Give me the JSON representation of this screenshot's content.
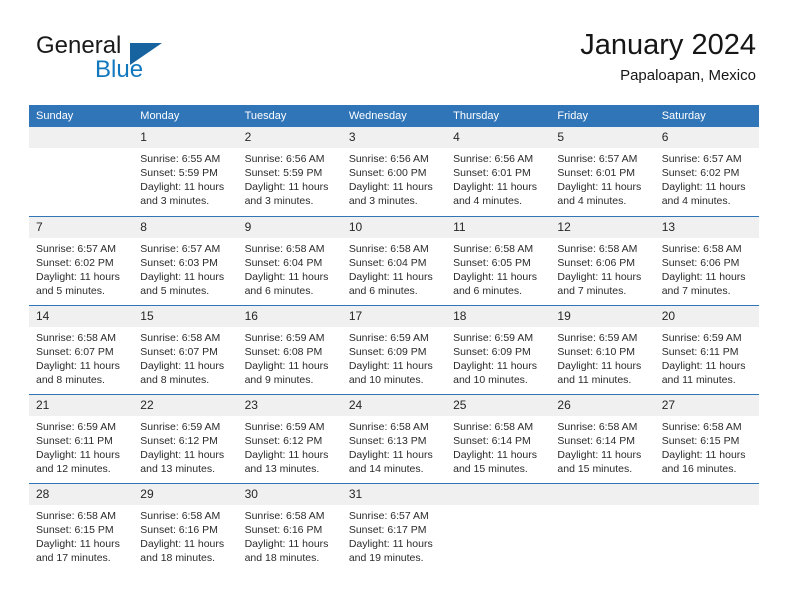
{
  "brand": {
    "name_part1": "General",
    "name_part2": "Blue",
    "logo_icon": "triangle-logo-icon"
  },
  "header": {
    "title": "January 2024",
    "subtitle": "Papaloapan, Mexico"
  },
  "calendar": {
    "weekday_headers": [
      "Sunday",
      "Monday",
      "Tuesday",
      "Wednesday",
      "Thursday",
      "Friday",
      "Saturday"
    ],
    "accent_color": "#3075b8",
    "daynum_background": "#f0f0f0",
    "weeks": [
      [
        {
          "day": "",
          "blank": true
        },
        {
          "day": "1",
          "sunrise": "Sunrise: 6:55 AM",
          "sunset": "Sunset: 5:59 PM",
          "daylight_line1": "Daylight: 11 hours",
          "daylight_line2": "and 3 minutes."
        },
        {
          "day": "2",
          "sunrise": "Sunrise: 6:56 AM",
          "sunset": "Sunset: 5:59 PM",
          "daylight_line1": "Daylight: 11 hours",
          "daylight_line2": "and 3 minutes."
        },
        {
          "day": "3",
          "sunrise": "Sunrise: 6:56 AM",
          "sunset": "Sunset: 6:00 PM",
          "daylight_line1": "Daylight: 11 hours",
          "daylight_line2": "and 3 minutes."
        },
        {
          "day": "4",
          "sunrise": "Sunrise: 6:56 AM",
          "sunset": "Sunset: 6:01 PM",
          "daylight_line1": "Daylight: 11 hours",
          "daylight_line2": "and 4 minutes."
        },
        {
          "day": "5",
          "sunrise": "Sunrise: 6:57 AM",
          "sunset": "Sunset: 6:01 PM",
          "daylight_line1": "Daylight: 11 hours",
          "daylight_line2": "and 4 minutes."
        },
        {
          "day": "6",
          "sunrise": "Sunrise: 6:57 AM",
          "sunset": "Sunset: 6:02 PM",
          "daylight_line1": "Daylight: 11 hours",
          "daylight_line2": "and 4 minutes."
        }
      ],
      [
        {
          "day": "7",
          "sunrise": "Sunrise: 6:57 AM",
          "sunset": "Sunset: 6:02 PM",
          "daylight_line1": "Daylight: 11 hours",
          "daylight_line2": "and 5 minutes."
        },
        {
          "day": "8",
          "sunrise": "Sunrise: 6:57 AM",
          "sunset": "Sunset: 6:03 PM",
          "daylight_line1": "Daylight: 11 hours",
          "daylight_line2": "and 5 minutes."
        },
        {
          "day": "9",
          "sunrise": "Sunrise: 6:58 AM",
          "sunset": "Sunset: 6:04 PM",
          "daylight_line1": "Daylight: 11 hours",
          "daylight_line2": "and 6 minutes."
        },
        {
          "day": "10",
          "sunrise": "Sunrise: 6:58 AM",
          "sunset": "Sunset: 6:04 PM",
          "daylight_line1": "Daylight: 11 hours",
          "daylight_line2": "and 6 minutes."
        },
        {
          "day": "11",
          "sunrise": "Sunrise: 6:58 AM",
          "sunset": "Sunset: 6:05 PM",
          "daylight_line1": "Daylight: 11 hours",
          "daylight_line2": "and 6 minutes."
        },
        {
          "day": "12",
          "sunrise": "Sunrise: 6:58 AM",
          "sunset": "Sunset: 6:06 PM",
          "daylight_line1": "Daylight: 11 hours",
          "daylight_line2": "and 7 minutes."
        },
        {
          "day": "13",
          "sunrise": "Sunrise: 6:58 AM",
          "sunset": "Sunset: 6:06 PM",
          "daylight_line1": "Daylight: 11 hours",
          "daylight_line2": "and 7 minutes."
        }
      ],
      [
        {
          "day": "14",
          "sunrise": "Sunrise: 6:58 AM",
          "sunset": "Sunset: 6:07 PM",
          "daylight_line1": "Daylight: 11 hours",
          "daylight_line2": "and 8 minutes."
        },
        {
          "day": "15",
          "sunrise": "Sunrise: 6:58 AM",
          "sunset": "Sunset: 6:07 PM",
          "daylight_line1": "Daylight: 11 hours",
          "daylight_line2": "and 8 minutes."
        },
        {
          "day": "16",
          "sunrise": "Sunrise: 6:59 AM",
          "sunset": "Sunset: 6:08 PM",
          "daylight_line1": "Daylight: 11 hours",
          "daylight_line2": "and 9 minutes."
        },
        {
          "day": "17",
          "sunrise": "Sunrise: 6:59 AM",
          "sunset": "Sunset: 6:09 PM",
          "daylight_line1": "Daylight: 11 hours",
          "daylight_line2": "and 10 minutes."
        },
        {
          "day": "18",
          "sunrise": "Sunrise: 6:59 AM",
          "sunset": "Sunset: 6:09 PM",
          "daylight_line1": "Daylight: 11 hours",
          "daylight_line2": "and 10 minutes."
        },
        {
          "day": "19",
          "sunrise": "Sunrise: 6:59 AM",
          "sunset": "Sunset: 6:10 PM",
          "daylight_line1": "Daylight: 11 hours",
          "daylight_line2": "and 11 minutes."
        },
        {
          "day": "20",
          "sunrise": "Sunrise: 6:59 AM",
          "sunset": "Sunset: 6:11 PM",
          "daylight_line1": "Daylight: 11 hours",
          "daylight_line2": "and 11 minutes."
        }
      ],
      [
        {
          "day": "21",
          "sunrise": "Sunrise: 6:59 AM",
          "sunset": "Sunset: 6:11 PM",
          "daylight_line1": "Daylight: 11 hours",
          "daylight_line2": "and 12 minutes."
        },
        {
          "day": "22",
          "sunrise": "Sunrise: 6:59 AM",
          "sunset": "Sunset: 6:12 PM",
          "daylight_line1": "Daylight: 11 hours",
          "daylight_line2": "and 13 minutes."
        },
        {
          "day": "23",
          "sunrise": "Sunrise: 6:59 AM",
          "sunset": "Sunset: 6:12 PM",
          "daylight_line1": "Daylight: 11 hours",
          "daylight_line2": "and 13 minutes."
        },
        {
          "day": "24",
          "sunrise": "Sunrise: 6:58 AM",
          "sunset": "Sunset: 6:13 PM",
          "daylight_line1": "Daylight: 11 hours",
          "daylight_line2": "and 14 minutes."
        },
        {
          "day": "25",
          "sunrise": "Sunrise: 6:58 AM",
          "sunset": "Sunset: 6:14 PM",
          "daylight_line1": "Daylight: 11 hours",
          "daylight_line2": "and 15 minutes."
        },
        {
          "day": "26",
          "sunrise": "Sunrise: 6:58 AM",
          "sunset": "Sunset: 6:14 PM",
          "daylight_line1": "Daylight: 11 hours",
          "daylight_line2": "and 15 minutes."
        },
        {
          "day": "27",
          "sunrise": "Sunrise: 6:58 AM",
          "sunset": "Sunset: 6:15 PM",
          "daylight_line1": "Daylight: 11 hours",
          "daylight_line2": "and 16 minutes."
        }
      ],
      [
        {
          "day": "28",
          "sunrise": "Sunrise: 6:58 AM",
          "sunset": "Sunset: 6:15 PM",
          "daylight_line1": "Daylight: 11 hours",
          "daylight_line2": "and 17 minutes."
        },
        {
          "day": "29",
          "sunrise": "Sunrise: 6:58 AM",
          "sunset": "Sunset: 6:16 PM",
          "daylight_line1": "Daylight: 11 hours",
          "daylight_line2": "and 18 minutes."
        },
        {
          "day": "30",
          "sunrise": "Sunrise: 6:58 AM",
          "sunset": "Sunset: 6:16 PM",
          "daylight_line1": "Daylight: 11 hours",
          "daylight_line2": "and 18 minutes."
        },
        {
          "day": "31",
          "sunrise": "Sunrise: 6:57 AM",
          "sunset": "Sunset: 6:17 PM",
          "daylight_line1": "Daylight: 11 hours",
          "daylight_line2": "and 19 minutes."
        },
        {
          "day": "",
          "blank": true
        },
        {
          "day": "",
          "blank": true
        },
        {
          "day": "",
          "blank": true
        }
      ]
    ]
  }
}
